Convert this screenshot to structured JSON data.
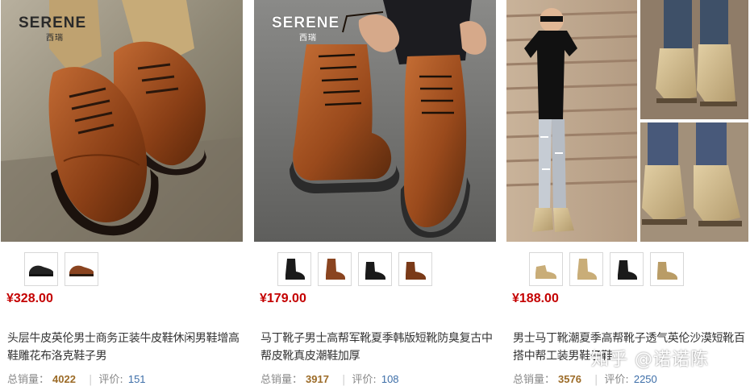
{
  "brand": {
    "name_latin": "SERENE",
    "name_cn": "西瑞"
  },
  "products": [
    {
      "price": "¥328.00",
      "title": "头层牛皮英伦男士商务正装牛皮鞋休闲男鞋增高鞋雕花布洛克鞋子男",
      "sales_label": "总销量：",
      "sales_value": "4022",
      "review_label": "评价: ",
      "review_value": "151",
      "thumbnails": [
        "black-derby-shoe",
        "brown-derby-shoe"
      ]
    },
    {
      "price": "¥179.00",
      "title": "马丁靴子男士高帮军靴夏季韩版短靴防臭复古中帮皮靴真皮潮鞋加厚",
      "sales_label": "总销量：",
      "sales_value": "3917",
      "review_label": "评价: ",
      "review_value": "108",
      "thumbnails": [
        "black-martin-boot",
        "brown-martin-boot",
        "black-martin-boot-2",
        "brown-martin-boot-2"
      ]
    },
    {
      "price": "¥188.00",
      "title": "男士马丁靴潮夏季高帮靴子透气英伦沙漠短靴百搭中帮工装男鞋子鞋",
      "sales_label": "总销量：",
      "sales_value": "3576",
      "review_label": "评价: ",
      "review_value": "2250",
      "thumbnails": [
        "tan-low-boot",
        "tan-high-boot",
        "black-high-boot",
        "sand-high-boot"
      ]
    }
  ],
  "watermark": "知乎 @诺诺陈",
  "colors": {
    "price": "#c40000",
    "sales": "#9c6b27",
    "review": "#3d6ea8",
    "thumb_border": "#d8d8d8"
  }
}
